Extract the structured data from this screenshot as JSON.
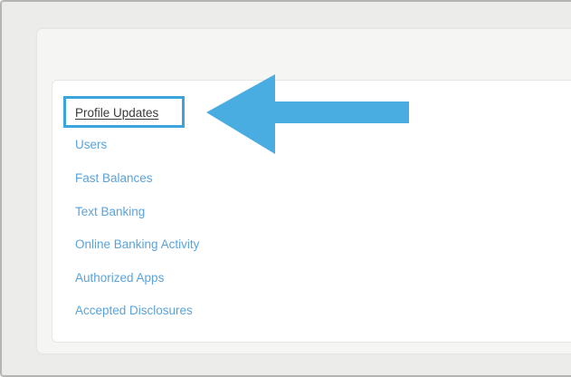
{
  "nav": {
    "items": [
      {
        "label": "Profile Updates",
        "active": true
      },
      {
        "label": "Users",
        "active": false
      },
      {
        "label": "Fast Balances",
        "active": false
      },
      {
        "label": "Text Banking",
        "active": false
      },
      {
        "label": "Online Banking Activity",
        "active": false
      },
      {
        "label": "Authorized Apps",
        "active": false
      },
      {
        "label": "Accepted Disclosures",
        "active": false
      }
    ]
  },
  "annotation": {
    "highlight_color": "#3aa5dd",
    "arrow_color": "#4aade2",
    "arrow_direction": "left"
  },
  "colors": {
    "link": "#5aa3da",
    "active_link": "#3a3a3a",
    "background": "#ececea"
  }
}
